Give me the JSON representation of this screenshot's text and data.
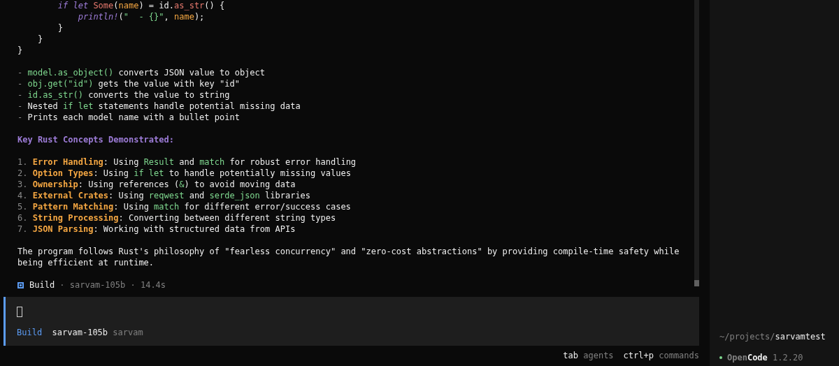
{
  "transcript": {
    "lines": [
      {
        "kind": "code",
        "segments": [
          {
            "text": "        if let",
            "kind": "keyword"
          },
          {
            "text": " Some",
            "kind": "type"
          },
          {
            "text": "(",
            "kind": "plain"
          },
          {
            "text": "name",
            "kind": "var"
          },
          {
            "text": ") = id.",
            "kind": "plain"
          },
          {
            "text": "as_str",
            "kind": "method"
          },
          {
            "text": "() {",
            "kind": "plain"
          }
        ]
      },
      {
        "kind": "code",
        "segments": [
          {
            "text": "            println!",
            "kind": "keyword"
          },
          {
            "text": "(",
            "kind": "plain"
          },
          {
            "text": "\"  - {}\"",
            "kind": "string"
          },
          {
            "text": ", ",
            "kind": "plain"
          },
          {
            "text": "name",
            "kind": "var"
          },
          {
            "text": ");",
            "kind": "plain"
          }
        ]
      },
      {
        "kind": "code",
        "segments": [
          {
            "text": "        }",
            "kind": "plain"
          }
        ]
      },
      {
        "kind": "code",
        "segments": [
          {
            "text": "    }",
            "kind": "plain"
          }
        ]
      },
      {
        "kind": "code",
        "segments": [
          {
            "text": "}",
            "kind": "plain"
          }
        ]
      },
      {
        "kind": "blank"
      },
      {
        "kind": "bullet",
        "segments": [
          {
            "text": "- ",
            "kind": "muted"
          },
          {
            "text": "model.as_object()",
            "kind": "code"
          },
          {
            "text": " converts JSON value to object",
            "kind": "plain"
          }
        ]
      },
      {
        "kind": "bullet",
        "segments": [
          {
            "text": "- ",
            "kind": "muted"
          },
          {
            "text": "obj.get(\"id\")",
            "kind": "code"
          },
          {
            "text": " gets the value with key \"id\"",
            "kind": "plain"
          }
        ]
      },
      {
        "kind": "bullet",
        "segments": [
          {
            "text": "- ",
            "kind": "muted"
          },
          {
            "text": "id.as_str()",
            "kind": "code"
          },
          {
            "text": " converts the value to string",
            "kind": "plain"
          }
        ]
      },
      {
        "kind": "bullet",
        "segments": [
          {
            "text": "- ",
            "kind": "muted"
          },
          {
            "text": "Nested ",
            "kind": "plain"
          },
          {
            "text": "if let",
            "kind": "code"
          },
          {
            "text": " statements handle potential missing data",
            "kind": "plain"
          }
        ]
      },
      {
        "kind": "bullet",
        "segments": [
          {
            "text": "- ",
            "kind": "muted"
          },
          {
            "text": "Prints each model name with a bullet point",
            "kind": "plain"
          }
        ]
      },
      {
        "kind": "blank"
      },
      {
        "kind": "heading",
        "segments": [
          {
            "text": "Key Rust Concepts Demonstrated:",
            "kind": "heading"
          }
        ]
      },
      {
        "kind": "blank"
      },
      {
        "kind": "numbered",
        "segments": [
          {
            "text": "1. ",
            "kind": "muted"
          },
          {
            "text": "Error Handling",
            "kind": "bold"
          },
          {
            "text": ": Using ",
            "kind": "plain"
          },
          {
            "text": "Result",
            "kind": "code"
          },
          {
            "text": " and ",
            "kind": "plain"
          },
          {
            "text": "match",
            "kind": "code"
          },
          {
            "text": " for robust error handling",
            "kind": "plain"
          }
        ]
      },
      {
        "kind": "numbered",
        "segments": [
          {
            "text": "2. ",
            "kind": "muted"
          },
          {
            "text": "Option Types",
            "kind": "bold"
          },
          {
            "text": ": Using ",
            "kind": "plain"
          },
          {
            "text": "if let",
            "kind": "code"
          },
          {
            "text": " to handle potentially missing values",
            "kind": "plain"
          }
        ]
      },
      {
        "kind": "numbered",
        "segments": [
          {
            "text": "3. ",
            "kind": "muted"
          },
          {
            "text": "Ownership",
            "kind": "bold"
          },
          {
            "text": ": Using references (",
            "kind": "plain"
          },
          {
            "text": "&",
            "kind": "code"
          },
          {
            "text": ") to avoid moving data",
            "kind": "plain"
          }
        ]
      },
      {
        "kind": "numbered",
        "segments": [
          {
            "text": "4. ",
            "kind": "muted"
          },
          {
            "text": "External Crates",
            "kind": "bold"
          },
          {
            "text": ": Using ",
            "kind": "plain"
          },
          {
            "text": "reqwest",
            "kind": "code"
          },
          {
            "text": " and ",
            "kind": "plain"
          },
          {
            "text": "serde_json",
            "kind": "code"
          },
          {
            "text": " libraries",
            "kind": "plain"
          }
        ]
      },
      {
        "kind": "numbered",
        "segments": [
          {
            "text": "5. ",
            "kind": "muted"
          },
          {
            "text": "Pattern Matching",
            "kind": "bold"
          },
          {
            "text": ": Using ",
            "kind": "plain"
          },
          {
            "text": "match",
            "kind": "code"
          },
          {
            "text": " for different error/success cases",
            "kind": "plain"
          }
        ]
      },
      {
        "kind": "numbered",
        "segments": [
          {
            "text": "6. ",
            "kind": "muted"
          },
          {
            "text": "String Processing",
            "kind": "bold"
          },
          {
            "text": ": Converting between different string types",
            "kind": "plain"
          }
        ]
      },
      {
        "kind": "numbered",
        "segments": [
          {
            "text": "7. ",
            "kind": "muted"
          },
          {
            "text": "JSON Parsing",
            "kind": "bold"
          },
          {
            "text": ": Working with structured data from APIs",
            "kind": "plain"
          }
        ]
      },
      {
        "kind": "blank"
      },
      {
        "kind": "paragraph",
        "segments": [
          {
            "text": "The program follows Rust's philosophy of \"fearless concurrency\" and \"zero-cost abstractions\" by providing compile-time safety while being efficient at runtime.",
            "kind": "plain"
          }
        ]
      },
      {
        "kind": "blank"
      }
    ],
    "build_status": {
      "agent": "Build",
      "detail": " · sarvam-105b · 14.4s"
    }
  },
  "prompt": {
    "agent": "Build",
    "model": "sarvam-105b",
    "provider": "sarvam"
  },
  "shortcuts": [
    {
      "key": "tab",
      "label": "agents"
    },
    {
      "key": "ctrl+p",
      "label": "commands"
    }
  ],
  "sidebar": {
    "path_prefix": "~/projects/",
    "path_name": "sarvamtest",
    "app_name_dim": "Open",
    "app_name_bright": "Code",
    "version": "1.2.20"
  }
}
